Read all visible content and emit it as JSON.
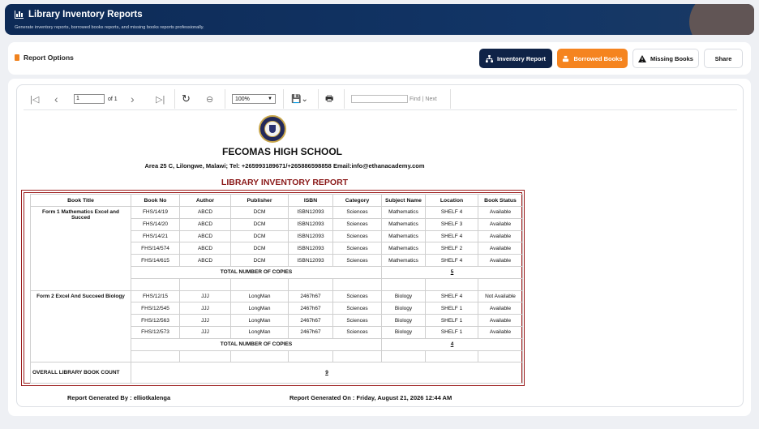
{
  "header": {
    "title": "Library Inventory Reports",
    "subtitle": "Generate inventory reports, borrowed books reports, and missing books reports professionally."
  },
  "options": {
    "label": "Report Options",
    "buttons": {
      "inventory": "Inventory Report",
      "borrowed": "Borrowed Books",
      "missing": "Missing Books",
      "share": "Share"
    },
    "accent": "#f5841f",
    "primary": "#0f2347"
  },
  "toolbar": {
    "page_value": "1",
    "page_of": "of 1",
    "zoom": "100%",
    "find_label": "Find",
    "next_label": "| Next"
  },
  "report": {
    "school_name": "FECOMAS HIGH SCHOOL",
    "address": "Area 25 C, Lilongwe, Malawi;  Tel: +265993189671/+265886598858   Email:info@ethanacademy.com",
    "report_title": "LIBRARY INVENTORY REPORT",
    "columns": [
      "Book Title",
      "Book No",
      "Author",
      "Publisher",
      "ISBN",
      "Category",
      "Subject Name",
      "Location",
      "Book Status"
    ],
    "groups": [
      {
        "title": "Form 1 Mathematics Excel and Succed",
        "rows": [
          [
            "FHS/14/19",
            "ABCD",
            "DCM",
            "ISBN12093",
            "Sciences",
            "Mathematics",
            "SHELF 4",
            "Available"
          ],
          [
            "FHS/14/20",
            "ABCD",
            "DCM",
            "ISBN12093",
            "Sciences",
            "Mathematics",
            "SHELF 3",
            "Available"
          ],
          [
            "FHS/14/21",
            "ABCD",
            "DCM",
            "ISBN12093",
            "Sciences",
            "Mathematics",
            "SHELF 4",
            "Available"
          ],
          [
            "FHS/14/574",
            "ABCD",
            "DCM",
            "ISBN12093",
            "Sciences",
            "Mathematics",
            "SHELF 2",
            "Available"
          ],
          [
            "FHS/14/615",
            "ABCD",
            "DCM",
            "ISBN12093",
            "Sciences",
            "Mathematics",
            "SHELF 4",
            "Available"
          ]
        ],
        "total_label": "TOTAL NUMBER OF COPIES",
        "total": "5"
      },
      {
        "title": "Form 2 Excel And Succeed Biology",
        "rows": [
          [
            "FHS/12/15",
            "JJJ",
            "LongMan",
            "2467h67",
            "Sciences",
            "Biology",
            "SHELF 4",
            "Not Available"
          ],
          [
            "FHS/12/545",
            "JJJ",
            "LongMan",
            "2467h67",
            "Sciences",
            "Biology",
            "SHELF 1",
            "Available"
          ],
          [
            "FHS/12/563",
            "JJJ",
            "LongMan",
            "2467h67",
            "Sciences",
            "Biology",
            "SHELF 1",
            "Available"
          ],
          [
            "FHS/12/573",
            "JJJ",
            "LongMan",
            "2467h67",
            "Sciences",
            "Biology",
            "SHELF 1",
            "Available"
          ]
        ],
        "total_label": "TOTAL NUMBER OF COPIES",
        "total": "4"
      }
    ],
    "overall_label": "OVERALL LIBRARY  BOOK COUNT",
    "overall_count": "9",
    "generated_by_label": "Report Generated By :",
    "generated_by": "elliotkalenga",
    "generated_on_label": "Report Generated On  :",
    "generated_on": "Friday, August 21, 2026 12:44 AM"
  }
}
